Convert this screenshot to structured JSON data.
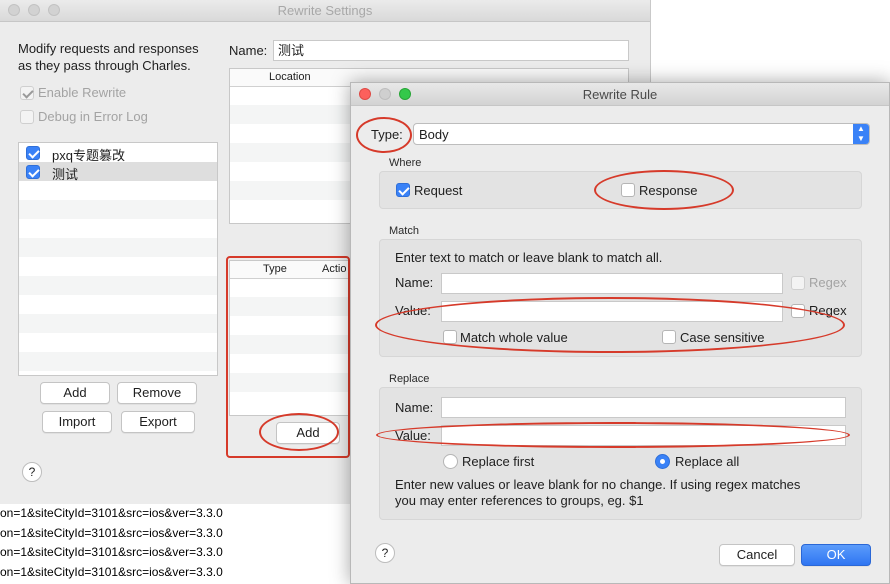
{
  "back_window": {
    "title": "Rewrite Settings",
    "description_line1": "Modify requests and responses",
    "description_line2": "as they pass through Charles.",
    "enable_rewrite_label": "Enable Rewrite",
    "debug_log_label": "Debug in Error Log",
    "name_label": "Name:",
    "name_value": "测试",
    "location_header": "Location",
    "type_header": "Type",
    "action_header": "Actio",
    "sets": [
      {
        "label": "pxq专题篡改",
        "checked": true
      },
      {
        "label": "测试",
        "checked": true
      }
    ],
    "buttons": {
      "add": "Add",
      "remove": "Remove",
      "import": "Import",
      "export": "Export",
      "rules_add": "Add",
      "help": "?"
    }
  },
  "front_window": {
    "title": "Rewrite Rule",
    "type_label": "Type:",
    "type_value": "Body",
    "where": {
      "label": "Where",
      "request_label": "Request",
      "request_checked": true,
      "response_label": "Response",
      "response_checked": false
    },
    "match": {
      "label": "Match",
      "instructions": "Enter text to match or leave blank to match all.",
      "name_label": "Name:",
      "name_value": "",
      "value_label": "Value:",
      "value_value": "",
      "regex_label": "Regex",
      "match_whole_label": "Match whole value",
      "case_sensitive_label": "Case sensitive"
    },
    "replace": {
      "label": "Replace",
      "name_label": "Name:",
      "name_value": "",
      "value_label": "Value:",
      "value_value": "",
      "replace_first_label": "Replace first",
      "replace_all_label": "Replace all",
      "selected": "Replace all",
      "help_line1": "Enter new values or leave blank for no change. If using regex matches",
      "help_line2": "you may enter references to groups, eg. $1"
    },
    "buttons": {
      "cancel": "Cancel",
      "ok": "OK",
      "help": "?"
    }
  },
  "background_log": [
    "on=1&siteCityId=3101&src=ios&ver=3.3.0",
    "on=1&siteCityId=3101&src=ios&ver=3.3.0",
    "on=1&siteCityId=3101&src=ios&ver=3.3.0",
    "on=1&siteCityId=3101&src=ios&ver=3.3.0"
  ],
  "colors": {
    "accent": "#3a82f7",
    "annotation_red": "#d63a2a"
  }
}
